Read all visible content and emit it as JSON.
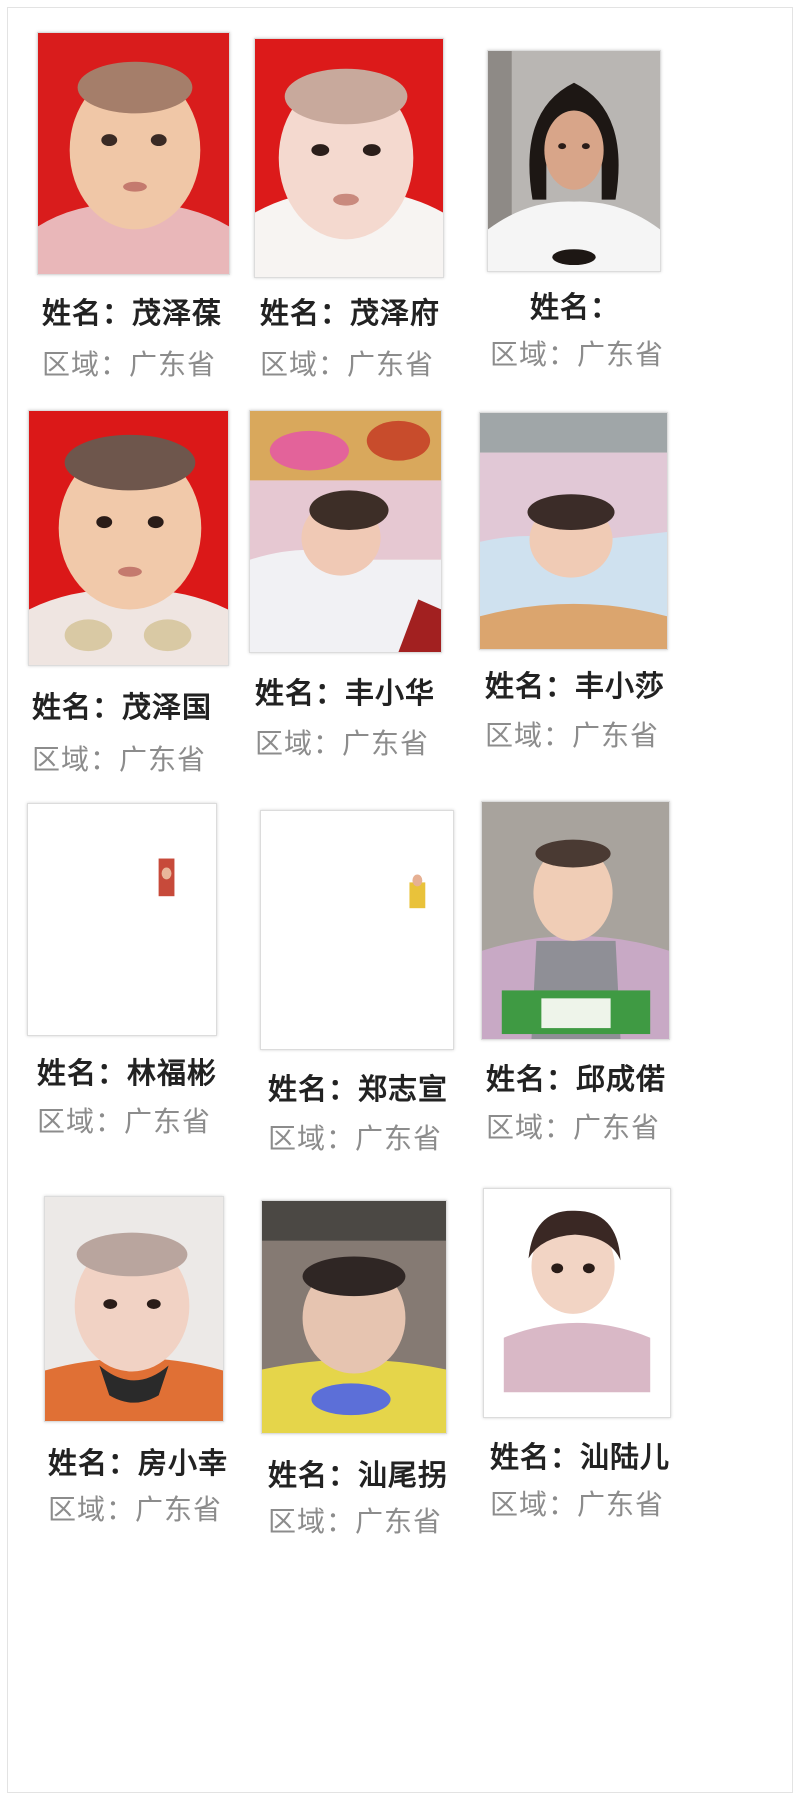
{
  "cards": [
    {
      "name": "姓名：茂泽葆",
      "region": "区域：广东省",
      "photo_type": "red-baby"
    },
    {
      "name": "姓名：茂泽府",
      "region": "区域：广东省",
      "photo_type": "red-baby-white"
    },
    {
      "name": "姓名：",
      "region": "区域：广东省",
      "photo_type": "woman"
    },
    {
      "name": "姓名：茂泽国",
      "region": "区域：广东省",
      "photo_type": "red-baby"
    },
    {
      "name": "姓名：丰小华",
      "region": "区域：广东省",
      "photo_type": "sleeping-baby"
    },
    {
      "name": "姓名：丰小莎",
      "region": "区域：广东省",
      "photo_type": "sleeping-baby-blue"
    },
    {
      "name": "姓名：林福彬",
      "region": "区域：广东省",
      "photo_type": "blank-small-red"
    },
    {
      "name": "姓名：郑志宣",
      "region": "区域：广东省",
      "photo_type": "blank-small-yellow"
    },
    {
      "name": "姓名：邱成偌",
      "region": "区域：广东省",
      "photo_type": "toddler-gray"
    },
    {
      "name": "姓名：房小幸",
      "region": "区域：广东省",
      "photo_type": "toddler-orange"
    },
    {
      "name": "姓名：汕尾拐",
      "region": "区域：广东省",
      "photo_type": "toddler-yellow"
    },
    {
      "name": "姓名：汕陆儿",
      "region": "区域：广东省",
      "photo_type": "toddler-pink"
    }
  ]
}
